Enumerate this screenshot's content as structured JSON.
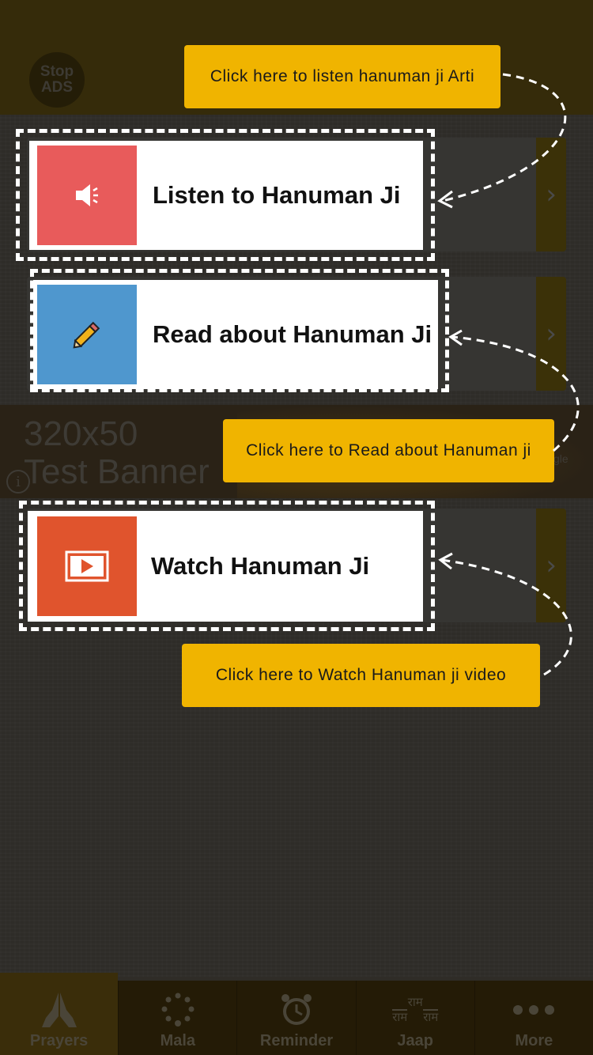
{
  "top": {
    "stop_ads": "Stop ADS"
  },
  "ad_banner": {
    "line1": "320x50",
    "line2": "Test Banner",
    "info": "i",
    "brand": "gle"
  },
  "cards": [
    {
      "label": "Listen to Hanuman Ji",
      "icon": "speaker-icon",
      "color": "#e85b5b"
    },
    {
      "label": "Read about Hanuman Ji",
      "icon": "pencil-icon",
      "color": "#4f97ce"
    },
    {
      "label": "Watch Hanuman Ji",
      "icon": "video-play-icon",
      "color": "#e0542d"
    }
  ],
  "tooltips": {
    "listen": "Click here to listen hanuman ji Arti",
    "read": "Click here to Read about Hanuman ji",
    "watch": "Click here to Watch Hanuman ji video"
  },
  "nav": {
    "items": [
      {
        "label": "Prayers",
        "icon": "praying-hands-icon",
        "active": true
      },
      {
        "label": "Mala",
        "icon": "mala-beads-icon"
      },
      {
        "label": "Reminder",
        "icon": "alarm-clock-icon"
      },
      {
        "label": "Jaap",
        "icon": "ram-text-icon",
        "glyph": "राम"
      },
      {
        "label": "More",
        "icon": "more-dots-icon"
      }
    ]
  },
  "colors": {
    "accent": "#f0b400",
    "top_bar": "#352b0a",
    "nav_bg": "#241b06"
  }
}
